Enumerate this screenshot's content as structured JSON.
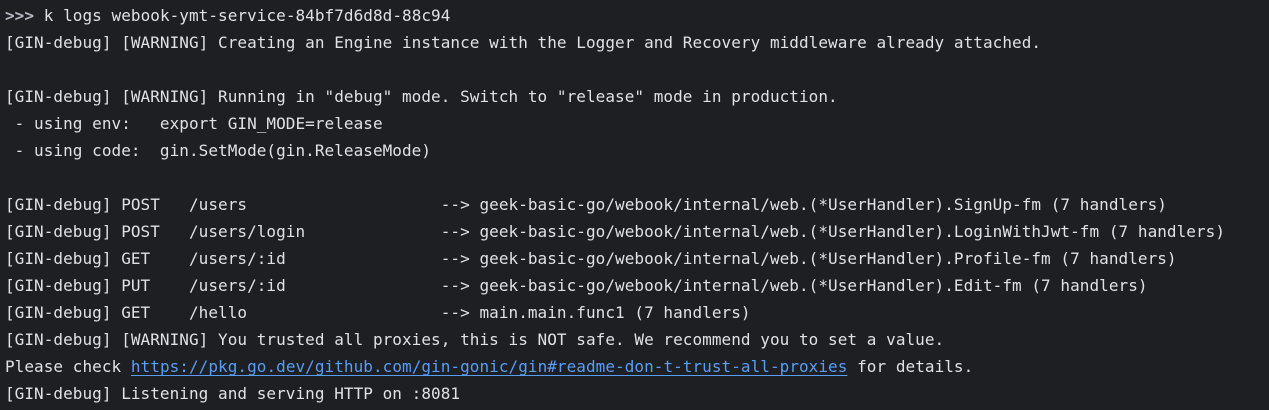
{
  "terminal": {
    "prompt_symbol": ">>>",
    "command": " k logs webook-ymt-service-84bf7d6d8d-88c94",
    "lines": [
      "[GIN-debug] [WARNING] Creating an Engine instance with the Logger and Recovery middleware already attached.",
      "",
      "[GIN-debug] [WARNING] Running in \"debug\" mode. Switch to \"release\" mode in production.",
      " - using env:   export GIN_MODE=release",
      " - using code:  gin.SetMode(gin.ReleaseMode)",
      "",
      "[GIN-debug] POST   /users                    --> geek-basic-go/webook/internal/web.(*UserHandler).SignUp-fm (7 handlers)",
      "[GIN-debug] POST   /users/login              --> geek-basic-go/webook/internal/web.(*UserHandler).LoginWithJwt-fm (7 handlers)",
      "[GIN-debug] GET    /users/:id                --> geek-basic-go/webook/internal/web.(*UserHandler).Profile-fm (7 handlers)",
      "[GIN-debug] PUT    /users/:id                --> geek-basic-go/webook/internal/web.(*UserHandler).Edit-fm (7 handlers)",
      "[GIN-debug] GET    /hello                    --> main.main.func1 (7 handlers)",
      "[GIN-debug] [WARNING] You trusted all proxies, this is NOT safe. We recommend you to set a value."
    ],
    "please_check": {
      "prefix": "Please check ",
      "url": "https://pkg.go.dev/github.com/gin-gonic/gin#readme-don-t-trust-all-proxies",
      "suffix": " for details."
    },
    "last_line": "[GIN-debug] Listening and serving HTTP on :8081"
  }
}
